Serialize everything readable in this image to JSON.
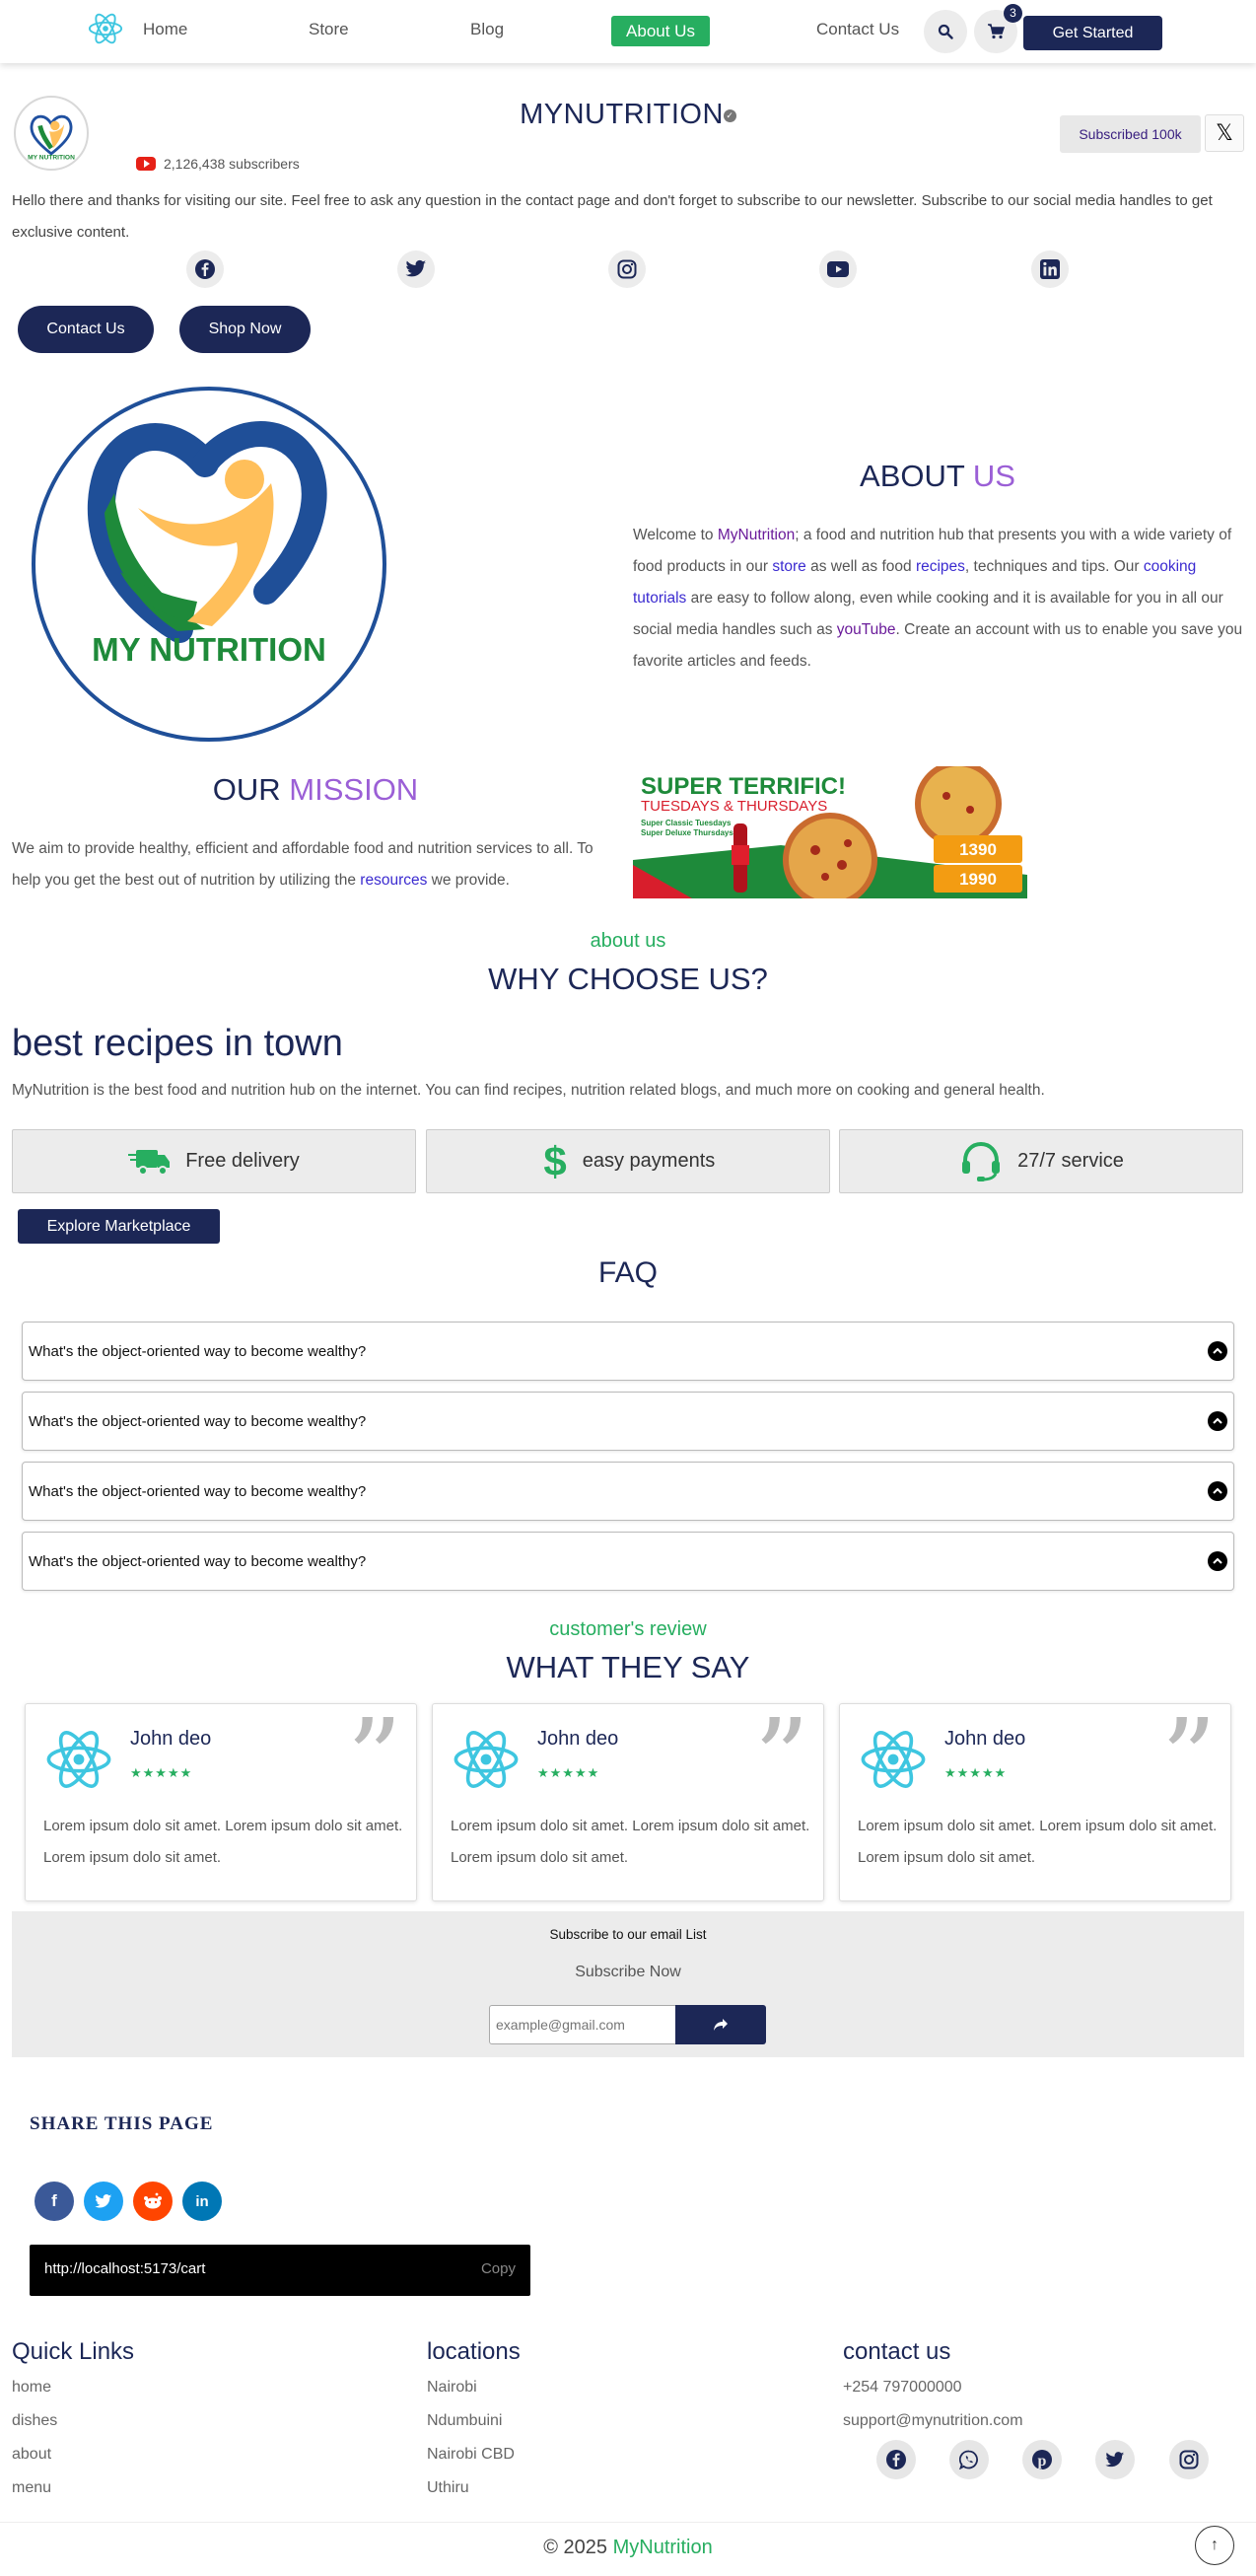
{
  "nav": {
    "items": [
      "Home",
      "Store",
      "Blog",
      "About Us",
      "Contact Us"
    ],
    "cart_count": "3",
    "cta": "Get Started"
  },
  "channel": {
    "title": "MYNUTRITION",
    "subscribers": "2,126,438 subscribers",
    "subscribed_label": "Subscribed 100k",
    "close_label": "𝕏",
    "intro": "Hello there and thanks for visiting our site. Feel free to ask any question in the contact page and don't forget to subscribe to our newsletter. Subscribe to our social media handles to get exclusive content.",
    "buttons": [
      "Contact Us",
      "Shop Now"
    ],
    "socials": [
      "facebook-icon",
      "twitter-icon",
      "instagram-icon",
      "youtube-icon",
      "linkedin-icon"
    ]
  },
  "about": {
    "logo_text": "MY NUTRITION",
    "heading_a": "ABOUT",
    "heading_b": "US",
    "p1": "Welcome to ",
    "brand": "MyNutrition",
    "p2": "; a food and nutrition hub that presents you with a wide variety of food products in our ",
    "store": "store",
    "p3": " as well as food ",
    "recipes": "recipes",
    "p4": ", techniques and tips. Our ",
    "cooking": "cooking tutorials",
    "p5": " are easy to follow along, even while cooking and it is available for you in all our social media handles such as ",
    "youtube": "youTube",
    "p6": ". Create an account with us to enable you save you favorite articles and feeds."
  },
  "mission": {
    "heading_a": "OUR",
    "heading_b": "MISSION",
    "p1": "We aim to provide healthy, efficient and affordable food and nutrition services to all. To help you get the best out of nutrition by utilizing the ",
    "resources": "resources",
    "p2": " we provide.",
    "banner": {
      "title": "SUPER TERRIFIC!",
      "subtitle": "TUESDAYS & THURSDAYS",
      "line1": "Super Classic Tuesdays",
      "line2": "Super Deluxe Thursdays",
      "price1": "1390",
      "price2": "1990"
    }
  },
  "why": {
    "kicker": "about us",
    "heading": "WHY CHOOSE US?",
    "big": "best recipes in town",
    "desc": "MyNutrition is the best food and nutrition hub on the internet. You can find recipes, nutrition related blogs, and much more on cooking and general health.",
    "features": [
      "Free delivery",
      "easy payments",
      "27/7 service"
    ],
    "explore": "Explore Marketplace"
  },
  "faq": {
    "heading": "FAQ",
    "items": [
      "What's the object-oriented way to become wealthy?",
      "What's the object-oriented way to become wealthy?",
      "What's the object-oriented way to become wealthy?",
      "What's the object-oriented way to become wealthy?"
    ]
  },
  "reviews": {
    "kicker": "customer's review",
    "heading": "WHAT THEY SAY",
    "cards": [
      {
        "name": "John deo",
        "stars": "★★★★★",
        "text": "Lorem ipsum dolo sit amet. Lorem ipsum dolo sit amet. Lorem ipsum dolo sit amet."
      },
      {
        "name": "John deo",
        "stars": "★★★★★",
        "text": "Lorem ipsum dolo sit amet. Lorem ipsum dolo sit amet. Lorem ipsum dolo sit amet."
      },
      {
        "name": "John deo",
        "stars": "★★★★★",
        "text": "Lorem ipsum dolo sit amet. Lorem ipsum dolo sit amet. Lorem ipsum dolo sit amet."
      }
    ],
    "rating": 4.5
  },
  "newsletter": {
    "title": "Subscribe to our email List",
    "subtitle": "Subscribe Now",
    "placeholder": "example@gmail.com"
  },
  "share": {
    "heading": "SHARE THIS PAGE",
    "url": "http://localhost:5173/cart",
    "copy": "Copy",
    "networks": [
      "f",
      "t",
      "r",
      "in"
    ]
  },
  "footer": {
    "quick_title": "Quick Links",
    "quick": [
      "home",
      "dishes",
      "about",
      "menu"
    ],
    "loc_title": "locations",
    "locations": [
      "Nairobi",
      "Ndumbuini",
      "Nairobi CBD",
      "Uthiru"
    ],
    "contact_title": "contact us",
    "phone": "+254 797000000",
    "email": "support@mynutrition.com",
    "copyright": "© 2025 ",
    "brand": "MyNutrition"
  },
  "colors": {
    "navy": "#1c2756",
    "green": "#27ae60",
    "purple": "#9b5fd6"
  }
}
